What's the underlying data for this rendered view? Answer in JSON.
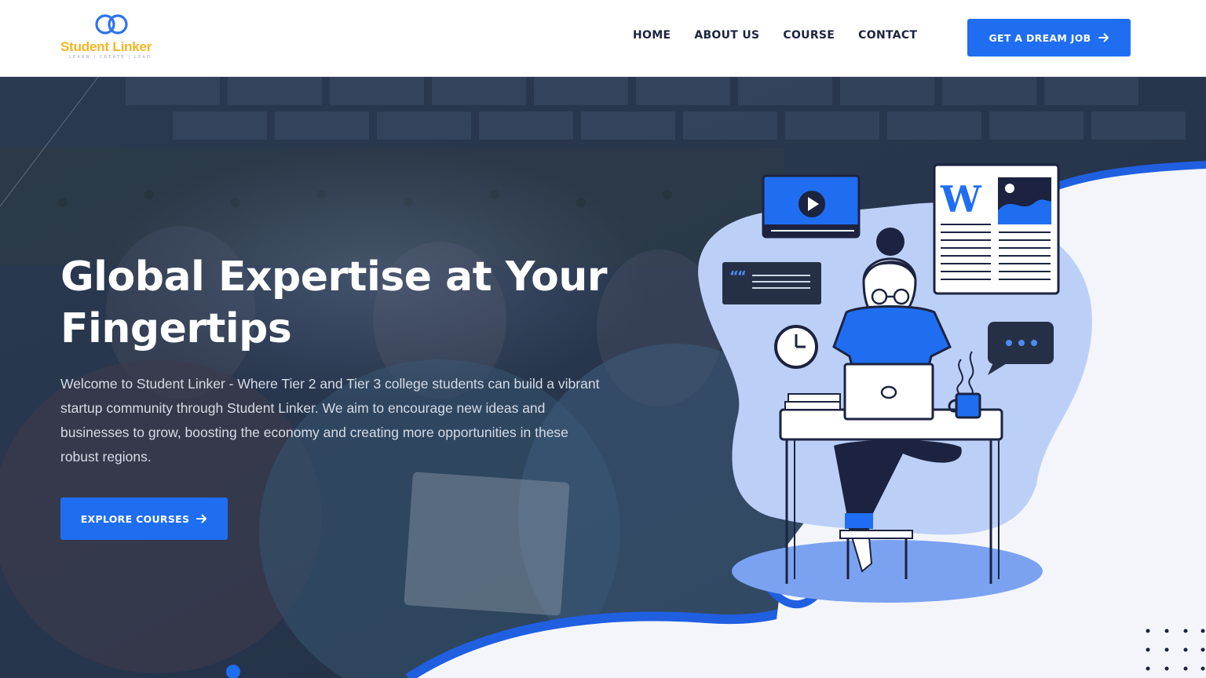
{
  "brand": {
    "name": "Student Linker",
    "tagline": "LEARN | CREATE | LEAD",
    "accent": "#1f6ef1",
    "logo_yellow": "#f5b521"
  },
  "nav": {
    "items": [
      {
        "label": "HOME"
      },
      {
        "label": "ABOUT US"
      },
      {
        "label": "COURSE"
      },
      {
        "label": "CONTACT"
      }
    ],
    "cta_label": "GET A DREAM JOB",
    "cta_icon": "arrow-right-icon"
  },
  "hero": {
    "title": "Global Expertise at Your Fingertips",
    "description": "Welcome to Student Linker - Where Tier 2 and Tier 3 college students can build a vibrant startup community through Student Linker. We aim to encourage new ideas and businesses to grow, boosting the economy and creating more opportunities in these robust regions.",
    "button_label": "EXPLORE COURSES",
    "button_icon": "arrow-right-icon"
  },
  "illustration": {
    "wiki_letter": "W",
    "icons": [
      "play-icon",
      "quote-icon",
      "clock-icon",
      "chat-dots-icon",
      "laptop-icon",
      "coffee-mug-icon"
    ]
  }
}
